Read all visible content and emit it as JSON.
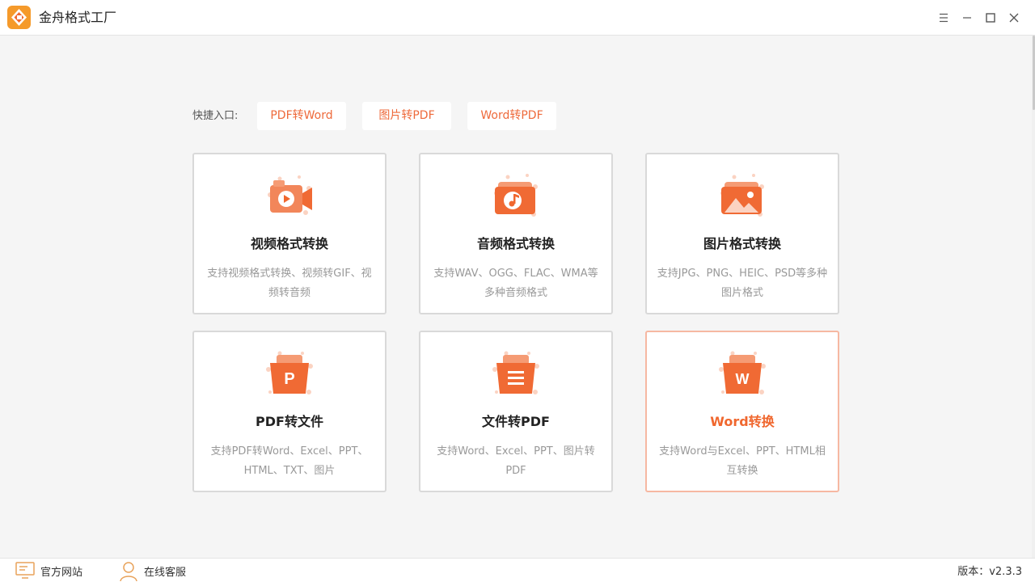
{
  "app": {
    "title": "金舟格式工厂",
    "window_controls": [
      "menu-icon",
      "minimize-icon",
      "maximize-icon",
      "close-icon"
    ]
  },
  "quick_entry": {
    "label": "快捷入口:",
    "buttons": [
      "PDF转Word",
      "图片转PDF",
      "Word转PDF"
    ]
  },
  "cards": [
    {
      "icon": "video-camera-icon",
      "title": "视频格式转换",
      "desc": "支持视频格式转换、视频转GIF、视频转音频"
    },
    {
      "icon": "music-note-icon",
      "title": "音频格式转换",
      "desc": "支持WAV、OGG、FLAC、WMA等多种音频格式"
    },
    {
      "icon": "image-icon",
      "title": "图片格式转换",
      "desc": "支持JPG、PNG、HEIC、PSD等多种图片格式"
    },
    {
      "icon": "pdf-file-icon",
      "title": "PDF转文件",
      "desc": "支持PDF转Word、Excel、PPT、HTML、TXT、图片"
    },
    {
      "icon": "document-icon",
      "title": "文件转PDF",
      "desc": "支持Word、Excel、PPT、图片转PDF"
    },
    {
      "icon": "word-file-icon",
      "title": "Word转换",
      "desc": "支持Word与Excel、PPT、HTML相互转换"
    }
  ],
  "footer": {
    "website_label": "官方网站",
    "support_label": "在线客服",
    "version": "版本：v2.3.3"
  },
  "colors": {
    "accent": "#f0672e",
    "accent_light": "#f6b8a2",
    "background": "#f5f5f5"
  }
}
